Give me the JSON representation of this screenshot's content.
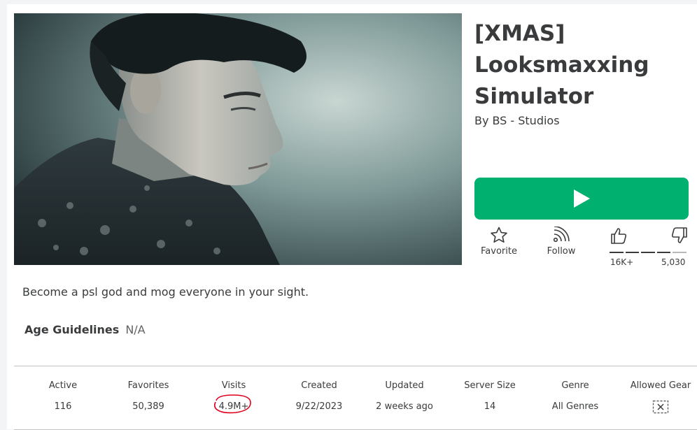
{
  "game": {
    "title": "[XMAS] Looksmaxxing Simulator",
    "by_label": "By",
    "creator": "BS - Studios",
    "description": "Become a psl god and mog everyone in your sight."
  },
  "actions": {
    "favorite_label": "Favorite",
    "follow_label": "Follow",
    "upvotes": "16K+",
    "downvotes": "5,030",
    "upvote_ratio": 0.76
  },
  "age_guidelines": {
    "label": "Age Guidelines",
    "value": "N/A"
  },
  "stats": [
    {
      "label": "Active",
      "value": "116"
    },
    {
      "label": "Favorites",
      "value": "50,389"
    },
    {
      "label": "Visits",
      "value": "4.9M+"
    },
    {
      "label": "Created",
      "value": "9/22/2023"
    },
    {
      "label": "Updated",
      "value": "2 weeks ago"
    },
    {
      "label": "Server Size",
      "value": "14"
    },
    {
      "label": "Genre",
      "value": "All Genres"
    },
    {
      "label": "Allowed Gear",
      "value": ""
    }
  ],
  "icons": {
    "play": "play-icon",
    "favorite": "star-icon",
    "follow": "rss-icon",
    "upvote": "thumbs-up-icon",
    "downvote": "thumbs-down-icon",
    "allowed_gear": "gear-not-allowed-icon"
  },
  "colors": {
    "play_button": "#00b06f",
    "annotation": "#e0001b"
  }
}
